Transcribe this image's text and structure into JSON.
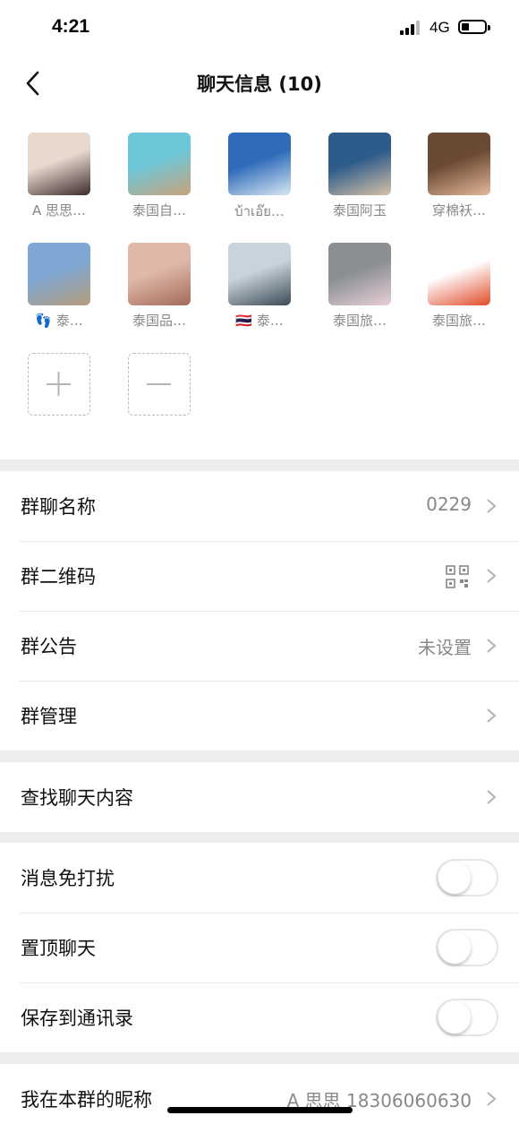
{
  "status": {
    "time": "4:21",
    "network": "4G"
  },
  "nav": {
    "title": "聊天信息 (10)"
  },
  "members": [
    {
      "name": "A 思思…",
      "colors": [
        "#e8d9cf",
        "#3a2b2b"
      ]
    },
    {
      "name": "泰国自…",
      "colors": [
        "#6ec7d8",
        "#c9a27a"
      ]
    },
    {
      "name": "บ้าเอ๊ย…",
      "colors": [
        "#2e6bb8",
        "#d9e7f5"
      ]
    },
    {
      "name": "泰国阿玉",
      "colors": [
        "#2d5b8a",
        "#d8c2a8"
      ]
    },
    {
      "name": "穿棉袄…",
      "colors": [
        "#6b4a33",
        "#e6b89a"
      ]
    },
    {
      "name": "👣 泰…",
      "colors": [
        "#7ea7d4",
        "#b49c7a"
      ]
    },
    {
      "name": "泰国品…",
      "colors": [
        "#e0b8a8",
        "#a36a5a"
      ]
    },
    {
      "name": "🇹🇭 泰…",
      "colors": [
        "#c7d4dc",
        "#3c4a56"
      ]
    },
    {
      "name": "泰国旅…",
      "colors": [
        "#8a8f94",
        "#e8cfd6"
      ]
    },
    {
      "name": "泰国旅…",
      "colors": [
        "#ffffff",
        "#e04b2a"
      ]
    }
  ],
  "settings": {
    "group_name": {
      "label": "群聊名称",
      "value": "0229"
    },
    "qr": {
      "label": "群二维码"
    },
    "announcement": {
      "label": "群公告",
      "value": "未设置"
    },
    "manage": {
      "label": "群管理"
    },
    "search": {
      "label": "查找聊天内容"
    },
    "mute": {
      "label": "消息免打扰",
      "on": false
    },
    "pin": {
      "label": "置顶聊天",
      "on": false
    },
    "save": {
      "label": "保存到通讯录",
      "on": false
    },
    "nickname": {
      "label": "我在本群的昵称",
      "value": "A 思思 18306060630"
    }
  }
}
